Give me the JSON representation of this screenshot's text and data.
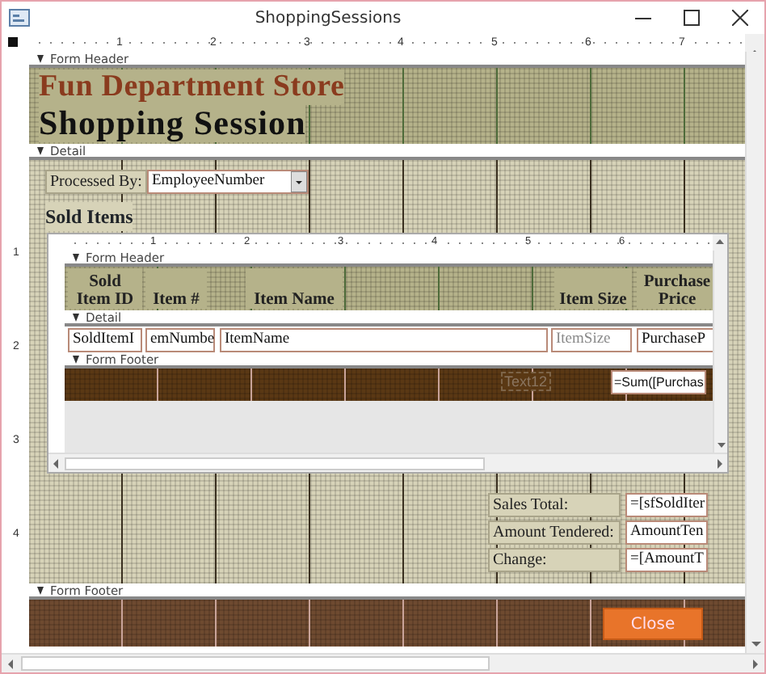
{
  "window": {
    "title": "ShoppingSessions"
  },
  "ruler_labels": [
    "1",
    "2",
    "3",
    "4",
    "5",
    "6",
    "7"
  ],
  "side_ruler_labels": [
    "1",
    "2",
    "3",
    "4"
  ],
  "form_header": {
    "section_label": "Form Header",
    "store_name": "Fun Department Store",
    "title": "Shopping Session"
  },
  "detail": {
    "section_label": "Detail",
    "processed_by": {
      "label": "Processed By:",
      "value": "EmployeeNumber"
    },
    "sold_items_label": "Sold Items",
    "subform": {
      "ruler_labels": [
        "1",
        "2",
        "3",
        "4",
        "5",
        "6"
      ],
      "header_label": "Form Header",
      "detail_label": "Detail",
      "footer_label": "Form Footer",
      "columns": [
        {
          "heading": [
            "Sold",
            "Item ID"
          ],
          "field": "SoldItemI"
        },
        {
          "heading": [
            "Item #"
          ],
          "field": "emNumbe"
        },
        {
          "heading": [
            "Item Name"
          ],
          "field": "ItemName"
        },
        {
          "heading": [
            "Item Size"
          ],
          "field": "ItemSize"
        },
        {
          "heading": [
            "Purchase",
            "Price"
          ],
          "field": "PurchaseP"
        }
      ],
      "footer_text": "Text12",
      "sum_field": "=Sum([Purchas"
    },
    "totals": [
      {
        "label": "Sales Total:",
        "value": "=[sfSoldIter"
      },
      {
        "label": "Amount Tendered:",
        "value": "AmountTen"
      },
      {
        "label": "Change:",
        "value": "=[AmountT"
      }
    ]
  },
  "form_footer": {
    "section_label": "Form Footer",
    "button": "Close"
  }
}
